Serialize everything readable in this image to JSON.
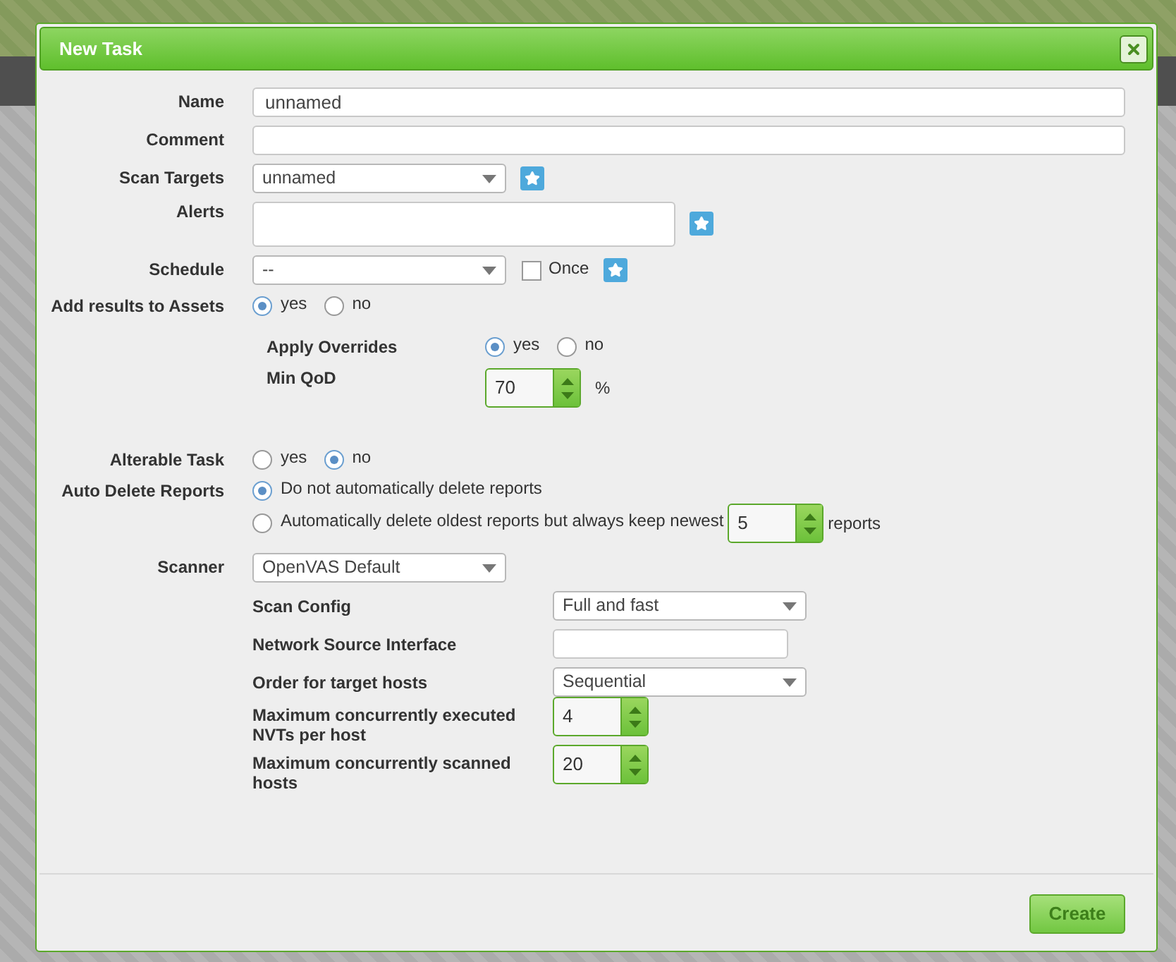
{
  "dialog": {
    "title": "New Task"
  },
  "name": {
    "label": "Name",
    "value": "unnamed"
  },
  "comment": {
    "label": "Comment"
  },
  "scan_targets": {
    "label": "Scan Targets",
    "value": "unnamed"
  },
  "alerts": {
    "label": "Alerts"
  },
  "schedule": {
    "label": "Schedule",
    "value": "--",
    "once": {
      "label": "Once",
      "checked": false
    }
  },
  "add_to_assets": {
    "label": "Add results to Assets",
    "options": [
      {
        "label": "yes",
        "selected": true
      },
      {
        "label": "no",
        "selected": false
      }
    ]
  },
  "apply_overrides": {
    "label": "Apply Overrides",
    "options": [
      {
        "label": "yes",
        "selected": true
      },
      {
        "label": "no",
        "selected": false
      }
    ]
  },
  "min_qod": {
    "label": "Min QoD",
    "value": "70",
    "unit": "%"
  },
  "alterable": {
    "label": "Alterable Task",
    "options": [
      {
        "label": "yes",
        "selected": false
      },
      {
        "label": "no",
        "selected": true
      }
    ]
  },
  "auto_delete": {
    "label": "Auto Delete Reports",
    "options": [
      {
        "label": "Do not automatically delete reports",
        "selected": true
      },
      {
        "label": "Automatically delete oldest reports but always keep newest",
        "selected": false
      }
    ],
    "keep": "5",
    "unit": "reports"
  },
  "scanner": {
    "label": "Scanner",
    "value": "OpenVAS Default"
  },
  "scanner_options": [
    {
      "kind": "select",
      "label": "Scan Config",
      "value": "Full and fast"
    },
    {
      "kind": "text",
      "label": "Network Source Interface"
    },
    {
      "kind": "select",
      "label": "Order for target hosts",
      "value": "Sequential"
    },
    {
      "kind": "spinner",
      "label": "Maximum concurrently executed NVTs per host",
      "value": "4"
    },
    {
      "kind": "spinner",
      "label": "Maximum concurrently scanned hosts",
      "value": "20"
    }
  ],
  "buttons": [
    {
      "label": "Create"
    }
  ]
}
